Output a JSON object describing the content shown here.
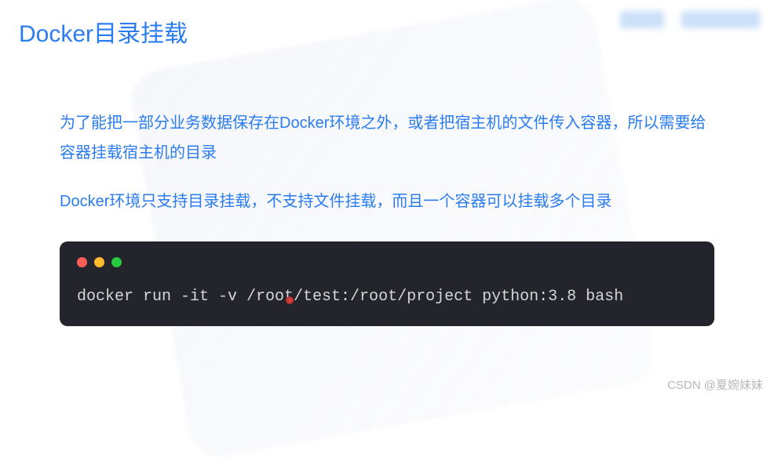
{
  "title": "Docker目录挂载",
  "paragraphs": {
    "p1": "为了能把一部分业务数据保存在Docker环境之外，或者把宿主机的文件传入容器，所以需要给容器挂载宿主机的目录",
    "p2": "Docker环境只支持目录挂载，不支持文件挂载，而且一个容器可以挂载多个目录"
  },
  "terminal": {
    "command": "docker run -it -v /root/test:/root/project python:3.8 bash"
  },
  "watermark": "CSDN @夏婉妹妹"
}
